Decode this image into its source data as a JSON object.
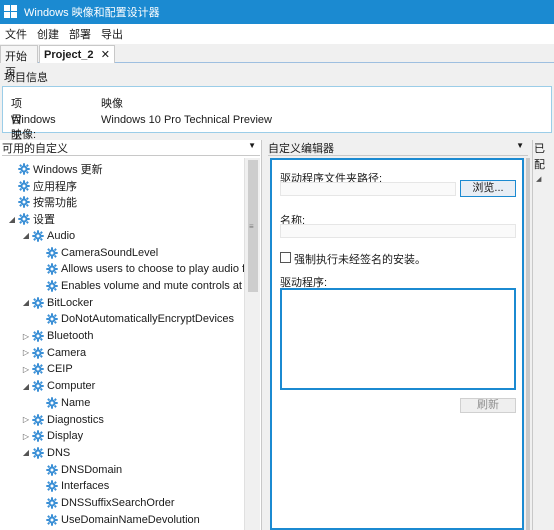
{
  "window": {
    "title": "Windows 映像和配置设计器"
  },
  "menu": [
    {
      "label": "文件"
    },
    {
      "label": "创建"
    },
    {
      "label": "部署"
    },
    {
      "label": "导出"
    }
  ],
  "tabs": {
    "start": "开始页",
    "project": "Project_2",
    "close_glyph": "✕"
  },
  "project_info": {
    "heading": "项目信息",
    "workflow_key": "项目工作流:",
    "workflow_value": "映像",
    "image_key": "Windows 映像:",
    "image_value": "Windows 10 Pro Technical Preview"
  },
  "panels": {
    "left_header": "可用的自定义",
    "mid_header": "自定义编辑器",
    "right_header": "已配"
  },
  "tree": [
    {
      "label": "Windows 更新",
      "expander": "",
      "indent": 1
    },
    {
      "label": "应用程序",
      "expander": "",
      "indent": 1
    },
    {
      "label": "按需功能",
      "expander": "",
      "indent": 1
    },
    {
      "label": "设置",
      "expander": "◢",
      "indent": 1
    },
    {
      "label": "Audio",
      "expander": "◢",
      "indent": 2
    },
    {
      "label": "CameraSoundLevel",
      "expander": "",
      "indent": 3
    },
    {
      "label": "Allows users to choose to play audio from t",
      "expander": "",
      "indent": 3
    },
    {
      "label": "Enables volume and mute controls at the W",
      "expander": "",
      "indent": 3
    },
    {
      "label": "BitLocker",
      "expander": "◢",
      "indent": 2
    },
    {
      "label": "DoNotAutomaticallyEncryptDevices",
      "expander": "",
      "indent": 3
    },
    {
      "label": "Bluetooth",
      "expander": "▷",
      "indent": 2
    },
    {
      "label": "Camera",
      "expander": "▷",
      "indent": 2
    },
    {
      "label": "CEIP",
      "expander": "▷",
      "indent": 2
    },
    {
      "label": "Computer",
      "expander": "◢",
      "indent": 2
    },
    {
      "label": "Name",
      "expander": "",
      "indent": 3
    },
    {
      "label": "Diagnostics",
      "expander": "▷",
      "indent": 2
    },
    {
      "label": "Display",
      "expander": "▷",
      "indent": 2
    },
    {
      "label": "DNS",
      "expander": "◢",
      "indent": 2
    },
    {
      "label": "DNSDomain",
      "expander": "",
      "indent": 3
    },
    {
      "label": "Interfaces",
      "expander": "",
      "indent": 3
    },
    {
      "label": "DNSSuffixSearchOrder",
      "expander": "",
      "indent": 3
    },
    {
      "label": "UseDomainNameDevolution",
      "expander": "",
      "indent": 3
    }
  ],
  "editor": {
    "driver_folder_label": "驱动程序文件夹路径:",
    "driver_folder_value": "",
    "browse_button": "浏览...",
    "name_label": "名称:",
    "name_value": "",
    "force_unsigned_label": "强制执行未经签名的安装。",
    "drivers_label": "驱动程序:",
    "refresh_button": "刷新"
  },
  "colors": {
    "accent": "#1b8ad1",
    "gear": "#3a8fd6"
  }
}
